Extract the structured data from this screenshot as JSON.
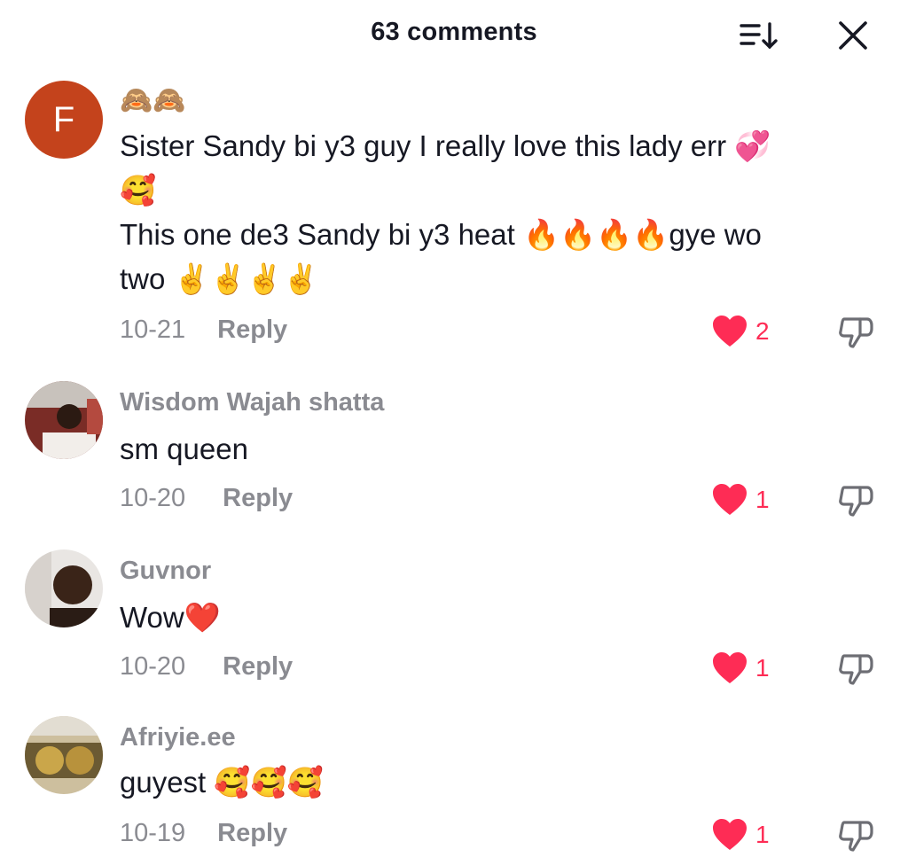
{
  "header": {
    "title": "63 comments"
  },
  "comments": [
    {
      "avatar_letter": "F",
      "username": "🙈🙈",
      "lines": [
        "Sister Sandy bi y3 guy I really love this lady err 💞",
        "🥰",
        "This one de3 Sandy bi y3 heat 🔥🔥🔥🔥gye wo",
        "two ✌️✌️✌️✌️"
      ],
      "date": "10-21",
      "reply": "Reply",
      "likes": "2"
    },
    {
      "username": "Wisdom Wajah shatta",
      "text": "sm queen",
      "date": "10-20",
      "reply": "Reply",
      "likes": "1"
    },
    {
      "username": "Guvnor",
      "text": "Wow❤️",
      "date": "10-20",
      "reply": "Reply",
      "likes": "1"
    },
    {
      "username": "Afriyie.ee",
      "text": "guyest 🥰🥰🥰",
      "date": "10-19",
      "reply": "Reply",
      "likes": "1"
    }
  ],
  "colors": {
    "like_red": "#fe2c55",
    "meta_gray": "#8a8b91",
    "avatar_f": "#c4431c"
  },
  "icons": {
    "sort": "sort-icon",
    "close": "close-icon",
    "like": "heart-icon",
    "dislike": "thumbs-down-icon"
  }
}
